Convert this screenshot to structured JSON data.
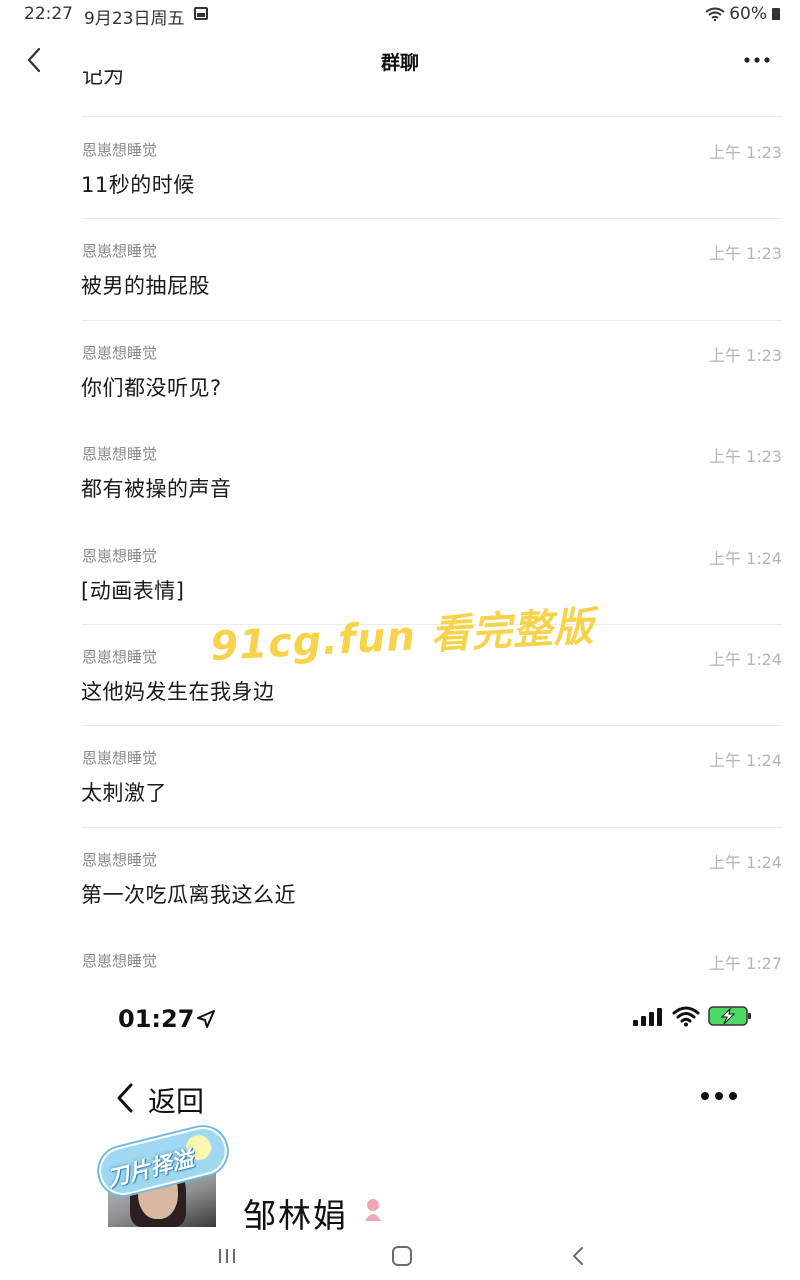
{
  "status_bar": {
    "time": "22:27",
    "date": "9月23日周五",
    "battery": "60%",
    "gallery_icon": "image-icon",
    "wifi_icon": "wifi-icon"
  },
  "nav": {
    "title": "群聊",
    "back_icon": "chevron-left-icon",
    "more_icon": "more-dots-icon"
  },
  "messages": [
    {
      "sender": "恩崽想睡觉",
      "time": "上午 1:23",
      "text": "11秒的时候"
    },
    {
      "sender": "恩崽想睡觉",
      "time": "上午 1:23",
      "text": "被男的抽屁股"
    },
    {
      "sender": "恩崽想睡觉",
      "time": "上午 1:23",
      "text": "你们都没听见?"
    },
    {
      "sender": "恩崽想睡觉",
      "time": "上午 1:23",
      "text": "都有被操的声音"
    },
    {
      "sender": "恩崽想睡觉",
      "time": "上午 1:24",
      "text": "[动画表情]"
    },
    {
      "sender": "恩崽想睡觉",
      "time": "上午 1:24",
      "text": "这他妈发生在我身边"
    },
    {
      "sender": "恩崽想睡觉",
      "time": "上午 1:24",
      "text": "太刺激了"
    },
    {
      "sender": "恩崽想睡觉",
      "time": "上午 1:24",
      "text": "第一次吃瓜离我这么近"
    },
    {
      "sender": "恩崽想睡觉",
      "time": "上午 1:27",
      "text": ""
    }
  ],
  "top_fragment": "记为",
  "watermark": "91cg.fun 看完整版",
  "inner_screenshot": {
    "time": "01:27",
    "location_icon": "location-arrow-icon",
    "back_label": "返回",
    "profile_name": "邹林娟",
    "badge_text": "刀片择溢"
  },
  "colors": {
    "sender": "#8a8a8a",
    "time": "#b5b5b5",
    "watermark": "#f7d34c",
    "battery_charging": "#4cd964"
  }
}
